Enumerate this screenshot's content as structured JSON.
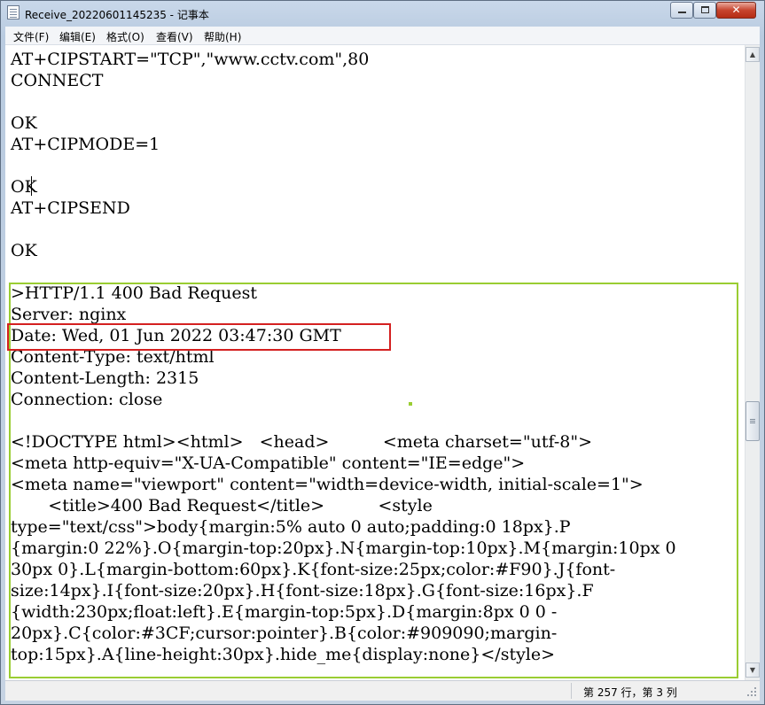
{
  "window": {
    "title": "Receive_20220601145235 - 记事本",
    "close_glyph": "✕"
  },
  "menu": [
    "文件(F)",
    "编辑(E)",
    "格式(O)",
    "查看(V)",
    "帮助(H)"
  ],
  "content_lines": [
    "AT+CIPSTART=\"TCP\",\"www.cctv.com\",80",
    "CONNECT",
    "",
    "OK",
    "AT+CIPMODE=1",
    "",
    "OK",
    "AT+CIPSEND",
    "",
    "OK",
    "",
    ">HTTP/1.1 400 Bad Request",
    "Server: nginx",
    "Date: Wed, 01 Jun 2022 03:47:30 GMT",
    "Content-Type: text/html",
    "Content-Length: 2315",
    "Connection: close",
    "",
    "<!DOCTYPE html><html>   <head>          <meta charset=\"utf-8\">",
    "<meta http-equiv=\"X-UA-Compatible\" content=\"IE=edge\">",
    "<meta name=\"viewport\" content=\"width=device-width, initial-scale=1\">",
    "       <title>400 Bad Request</title>          <style",
    "type=\"text/css\">body{margin:5% auto 0 auto;padding:0 18px}.P",
    "{margin:0 22%}.O{margin-top:20px}.N{margin-top:10px}.M{margin:10px 0",
    "30px 0}.L{margin-bottom:60px}.K{font-size:25px;color:#F90}.J{font-",
    "size:14px}.I{font-size:20px}.H{font-size:18px}.G{font-size:16px}.F",
    "{width:230px;float:left}.E{margin-top:5px}.D{margin:8px 0 0 -",
    "20px}.C{color:#3CF;cursor:pointer}.B{color:#909090;margin-",
    "top:15px}.A{line-height:30px}.hide_me{display:none}</style>"
  ],
  "status": {
    "position": "第 257 行，第 3 列"
  },
  "colors": {
    "highlight_green": "#9acd32",
    "highlight_red": "#d42020"
  }
}
